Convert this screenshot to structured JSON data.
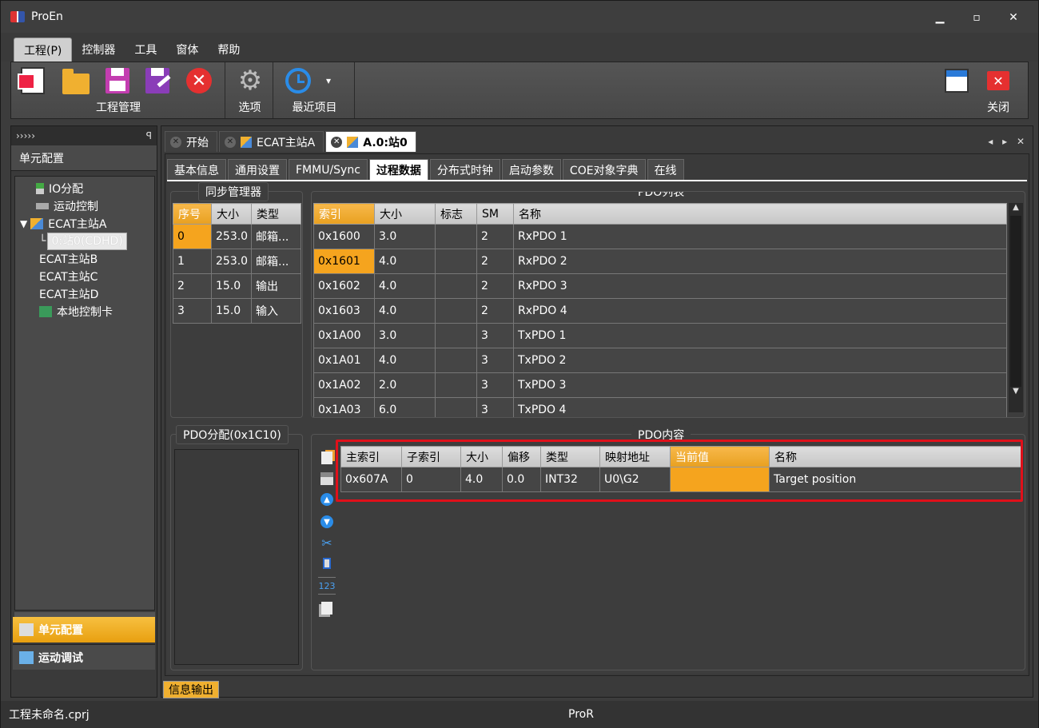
{
  "app": {
    "title": "ProEn"
  },
  "window_controls": {
    "minimize": "▁",
    "maximize": "▫",
    "close": "✕"
  },
  "menu": [
    {
      "label": "工程(P)",
      "active": true
    },
    {
      "label": "控制器"
    },
    {
      "label": "工具"
    },
    {
      "label": "窗体"
    },
    {
      "label": "帮助"
    }
  ],
  "ribbon": {
    "groups": {
      "project": "工程管理",
      "options": "选项",
      "recent": "最近项目",
      "close": "关闭"
    },
    "recent_arrow": "▾"
  },
  "left_panel": {
    "header": "›››››",
    "pin": "ꟼ",
    "title": "单元配置",
    "tree": [
      {
        "label": "IO分配",
        "icon": "io-icon"
      },
      {
        "label": "运动控制",
        "icon": "motion-icon"
      },
      {
        "label": "ECAT主站A",
        "icon": "ecat-master-icon",
        "expanded": true
      },
      {
        "label": "0:站0(CDHD)",
        "selected": true
      },
      {
        "label": "ECAT主站B"
      },
      {
        "label": "ECAT主站C"
      },
      {
        "label": "ECAT主站D"
      },
      {
        "label": "本地控制卡",
        "icon": "card-icon"
      }
    ],
    "btn_unit_config": "单元配置",
    "btn_motion_debug": "运动调试"
  },
  "doc_tabs": [
    {
      "label": "开始"
    },
    {
      "label": "ECAT主站A"
    },
    {
      "label": "A.0:站0",
      "active": true
    }
  ],
  "doc_tab_nav": "◂ ▸ ✕",
  "sub_tabs": [
    "基本信息",
    "通用设置",
    "FMMU/Sync",
    "过程数据",
    "分布式时钟",
    "启动参数",
    "COE对象字典",
    "在线"
  ],
  "sub_tab_active": "过程数据",
  "sync_manager": {
    "title": "同步管理器",
    "columns": [
      "序号",
      "大小",
      "类型"
    ],
    "rows": [
      [
        "0",
        "253.0",
        "邮箱..."
      ],
      [
        "1",
        "253.0",
        "邮箱..."
      ],
      [
        "2",
        "15.0",
        "输出"
      ],
      [
        "3",
        "15.0",
        "输入"
      ]
    ]
  },
  "pdo_list": {
    "title": "PDO列表",
    "columns": [
      "索引",
      "大小",
      "标志",
      "SM",
      "名称"
    ],
    "rows": [
      [
        "0x1600",
        "3.0",
        "",
        "2",
        "RxPDO 1"
      ],
      [
        "0x1601",
        "4.0",
        "",
        "2",
        "RxPDO 2"
      ],
      [
        "0x1602",
        "4.0",
        "",
        "2",
        "RxPDO 3"
      ],
      [
        "0x1603",
        "4.0",
        "",
        "2",
        "RxPDO 4"
      ],
      [
        "0x1A00",
        "3.0",
        "",
        "3",
        "TxPDO 1"
      ],
      [
        "0x1A01",
        "4.0",
        "",
        "3",
        "TxPDO 2"
      ],
      [
        "0x1A02",
        "2.0",
        "",
        "3",
        "TxPDO 3"
      ],
      [
        "0x1A03",
        "6.0",
        "",
        "3",
        "TxPDO 4"
      ]
    ]
  },
  "pdo_assign": {
    "title": "PDO分配(0x1C10)"
  },
  "pdo_content": {
    "title": "PDO内容",
    "columns": [
      "主索引",
      "子索引",
      "大小",
      "偏移",
      "类型",
      "映射地址",
      "当前值",
      "名称"
    ],
    "rows": [
      [
        "0x607A",
        "0",
        "4.0",
        "0.0",
        "INT32",
        "U0\\G2",
        "",
        "Target position"
      ]
    ]
  },
  "toolbar_icons": [
    "add-icon",
    "delete-icon",
    "move-up-icon",
    "move-down-icon",
    "cut-icon",
    "device-icon",
    "number-icon",
    "copy-icon"
  ],
  "toolbar_number_label": "123",
  "bottom_tab": "信息输出",
  "status": {
    "left": "工程未命名.cprj",
    "center": "ProR"
  },
  "colors": {
    "accent": "#f5a41e",
    "highlight_box": "#e0101a",
    "background": "#3a3a3a"
  }
}
